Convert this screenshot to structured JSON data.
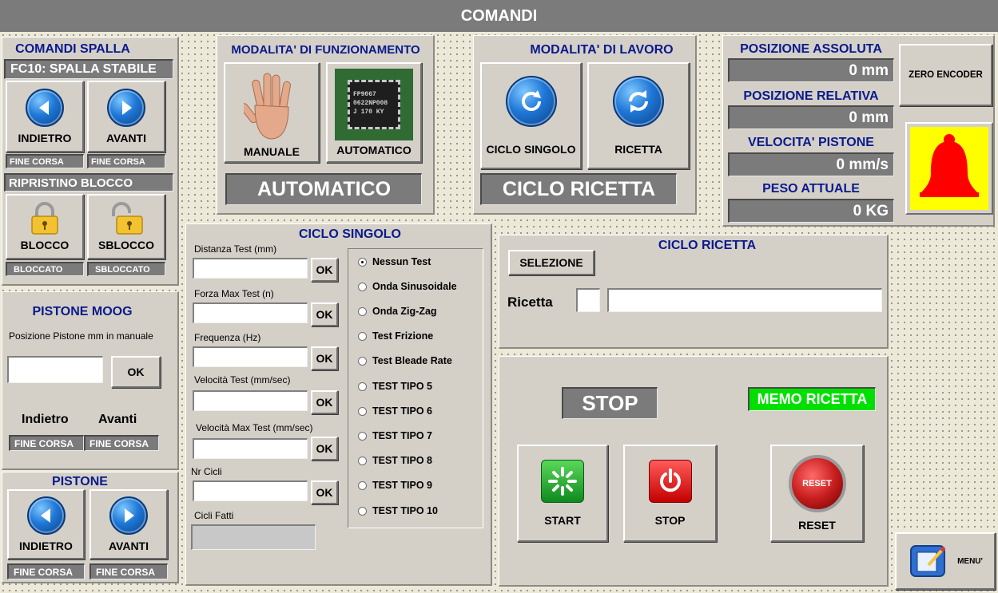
{
  "title": "COMANDI",
  "spalla": {
    "title": "COMANDI SPALLA",
    "status": "FC10: SPALLA STABILE",
    "indietro_label": "INDIETRO",
    "avanti_label": "AVANTI",
    "fine_corsa_left": "FINE CORSA",
    "fine_corsa_right": "FINE CORSA",
    "ripristino": "RIPRISTINO BLOCCO",
    "blocco_label": "BLOCCO",
    "sblocco_label": "SBLOCCO",
    "bloccato_status": "BLOCCATO",
    "sbloccato_status": "SBLOCCATO"
  },
  "moog": {
    "title": "PISTONE MOOG",
    "pos_label": "Posizione Pistone mm in manuale",
    "pos_value": "",
    "ok": "OK",
    "indietro": "Indietro",
    "avanti": "Avanti",
    "fine_corsa_left": "FINE CORSA",
    "fine_corsa_right": "FINE CORSA"
  },
  "pistone": {
    "title": "PISTONE",
    "indietro_label": "INDIETRO",
    "avanti_label": "AVANTI",
    "fine_corsa_left": "FINE CORSA",
    "fine_corsa_right": "FINE CORSA"
  },
  "modalita_funz": {
    "title": "MODALITA' DI FUNZIONAMENTO",
    "manuale": "MANUALE",
    "automatico": "AUTOMATICO",
    "current": "AUTOMATICO",
    "chip_text": "FP9067\n0622NP008\nJ 170 KY"
  },
  "modalita_lavoro": {
    "title": "MODALITA' DI LAVORO",
    "ciclo_singolo": "CICLO SINGOLO",
    "ricetta": "RICETTA",
    "current": "CICLO RICETTA"
  },
  "posizioni": {
    "assoluta_label": "POSIZIONE ASSOLUTA",
    "assoluta_value": "0 mm",
    "relativa_label": "POSIZIONE RELATIVA",
    "relativa_value": "0 mm",
    "velocita_label": "VELOCITA' PISTONE",
    "velocita_value": "0 mm/s",
    "peso_label": "PESO ATTUALE",
    "peso_value": "0 KG",
    "zero_encoder": "ZERO ENCODER"
  },
  "ciclo_singolo": {
    "title": "CICLO SINGOLO",
    "fields": [
      {
        "label": "Distanza Test (mm)",
        "value": "",
        "ok": "OK"
      },
      {
        "label": "Forza Max Test (n)",
        "value": "",
        "ok": "OK"
      },
      {
        "label": "Frequenza (Hz)",
        "value": "",
        "ok": "OK"
      },
      {
        "label": "Velocità Test (mm/sec)",
        "value": "",
        "ok": "OK"
      },
      {
        "label": "Velocità Max Test (mm/sec)",
        "value": "",
        "ok": "OK"
      },
      {
        "label": "Nr Cicli",
        "value": "",
        "ok": "OK"
      }
    ],
    "cicli_fatti_label": "Cicli Fatti",
    "cicli_fatti_value": "",
    "options": [
      {
        "label": "Nessun Test",
        "selected": true
      },
      {
        "label": "Onda Sinusoidale",
        "selected": false
      },
      {
        "label": "Onda Zig-Zag",
        "selected": false
      },
      {
        "label": "Test Frizione",
        "selected": false
      },
      {
        "label": "Test Bleade Rate",
        "selected": false
      },
      {
        "label": "TEST TIPO 5",
        "selected": false
      },
      {
        "label": "TEST TIPO 6",
        "selected": false
      },
      {
        "label": "TEST TIPO 7",
        "selected": false
      },
      {
        "label": "TEST TIPO 8",
        "selected": false
      },
      {
        "label": "TEST TIPO 9",
        "selected": false
      },
      {
        "label": "TEST TIPO 10",
        "selected": false
      }
    ]
  },
  "ciclo_ricetta": {
    "title": "CICLO RICETTA",
    "selezione": "SELEZIONE",
    "ricetta_label": "Ricetta",
    "ricetta_num": "",
    "ricetta_name": ""
  },
  "control": {
    "status": "STOP",
    "memo": "MEMO RICETTA",
    "start": "START",
    "stop": "STOP",
    "reset": "RESET",
    "reset_icon_text": "RESET",
    "menu": "MENU'"
  },
  "colors": {
    "title_bar": "#7b7b7b",
    "panel": "#d4d0c8",
    "title_blue": "#0a1a8c",
    "memo_green": "#00e000",
    "alarm_bell": "#ff0000",
    "alarm_bg": "#ffff00"
  }
}
